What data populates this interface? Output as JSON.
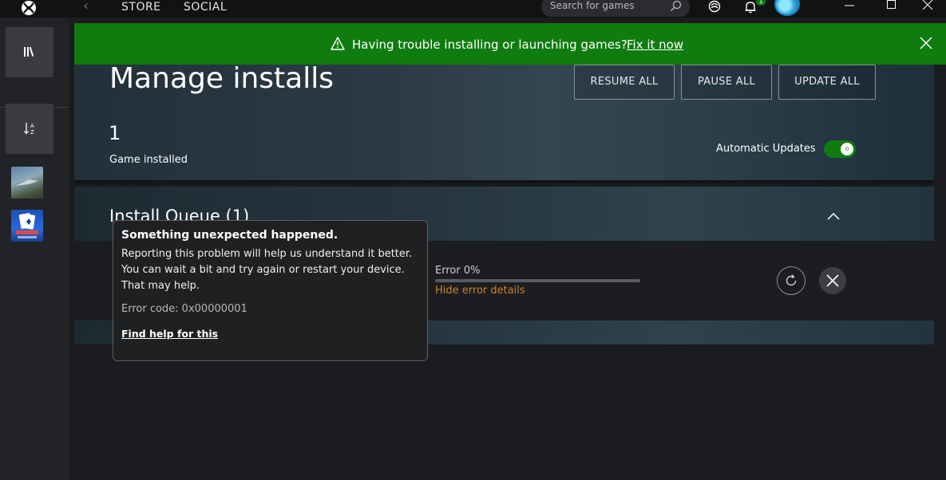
{
  "titlebar": {
    "nav_tabs": [
      "STORE",
      "SOCIAL"
    ],
    "search_placeholder": "Search for games",
    "notification_count": "1"
  },
  "banner": {
    "message": "Having trouble installing or launching games?",
    "link": "Fix it now"
  },
  "manage": {
    "title": "Manage installs",
    "buttons": [
      "RESUME ALL",
      "PAUSE ALL",
      "UPDATE ALL"
    ],
    "count": "1",
    "count_label": "Game installed",
    "auto_updates_label": "Automatic Updates",
    "auto_updates_on": true
  },
  "queue": {
    "title": "Install Queue (1)",
    "status": "Error 0%",
    "progress": 0,
    "hide_details": "Hide error details"
  },
  "tooltip": {
    "title": "Something unexpected happened.",
    "body": "Reporting this problem will help us understand it better. You can wait a bit and try again or restart your device. That may help.",
    "error_code": "Error code: 0x00000001",
    "link": "Find help for this"
  },
  "colors": {
    "accent_green": "#107c10",
    "error_link": "#c8842d"
  }
}
